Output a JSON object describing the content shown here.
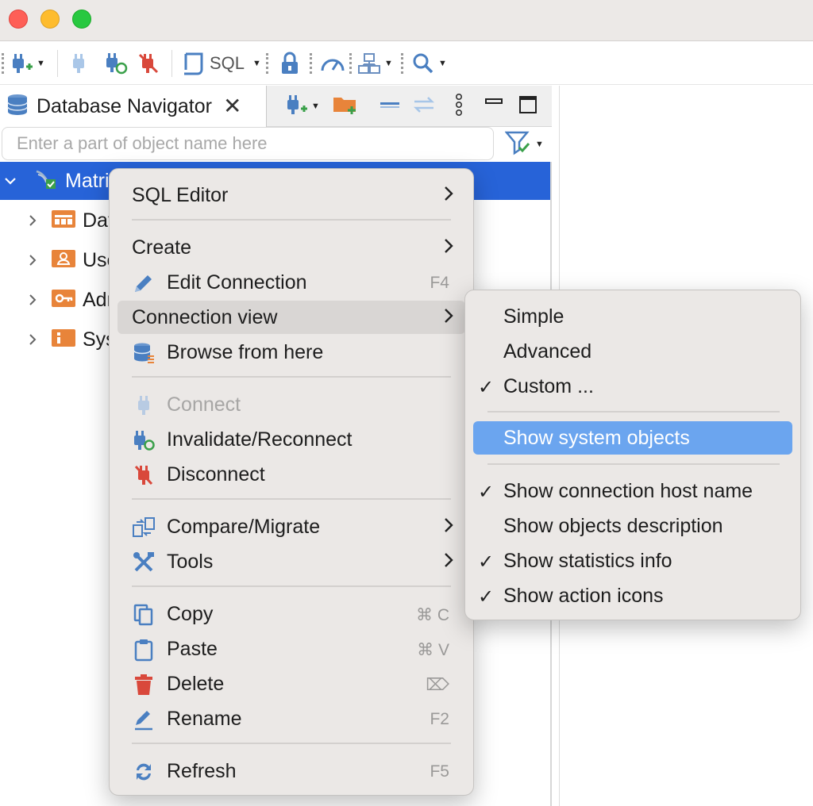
{
  "toolbar": {
    "sql_label": "SQL",
    "icons": [
      "new-connection-icon",
      "connect-icon",
      "reconnect-icon",
      "disconnect-icon",
      "sql-editor-icon",
      "transaction-lock-icon",
      "dashboard-icon",
      "navigator-tree-icon",
      "search-icon"
    ]
  },
  "navigator": {
    "tab_title": "Database Navigator",
    "search_placeholder": "Enter a part of object name here",
    "tree": [
      {
        "label": "Matri",
        "expanded": true,
        "selected": true
      },
      {
        "label": "Dat",
        "expanded": false
      },
      {
        "label": "Use",
        "expanded": false
      },
      {
        "label": "Adr",
        "expanded": false
      },
      {
        "label": "Sys",
        "expanded": false
      }
    ]
  },
  "context_menu": {
    "items": {
      "sql_editor": "SQL Editor",
      "create": "Create",
      "edit_connection": "Edit Connection",
      "edit_connection_shortcut": "F4",
      "connection_view": "Connection view",
      "browse_from_here": "Browse from here",
      "connect": "Connect",
      "invalidate_reconnect": "Invalidate/Reconnect",
      "disconnect": "Disconnect",
      "compare_migrate": "Compare/Migrate",
      "tools": "Tools",
      "copy": "Copy",
      "copy_shortcut": "⌘ C",
      "paste": "Paste",
      "paste_shortcut": "⌘ V",
      "delete": "Delete",
      "delete_shortcut": "⌦",
      "rename": "Rename",
      "rename_shortcut": "F2",
      "refresh": "Refresh",
      "refresh_shortcut": "F5"
    },
    "highlighted": "Connection view"
  },
  "connection_view_submenu": {
    "items": {
      "simple": "Simple",
      "advanced": "Advanced",
      "custom": "Custom ...",
      "show_system_objects": "Show system objects",
      "show_connection_host_name": "Show connection host name",
      "show_objects_description": "Show objects description",
      "show_statistics_info": "Show statistics info",
      "show_action_icons": "Show action icons"
    },
    "check_mark": "✓",
    "checked": [
      "Custom ...",
      "Show connection host name",
      "Show statistics info",
      "Show action icons"
    ],
    "selected": "Show system objects"
  },
  "colors": {
    "selection_blue": "#2763d8",
    "menu_selection": "#6ba5ef",
    "menu_background": "#ebe8e6",
    "folder_orange": "#e8843a"
  }
}
